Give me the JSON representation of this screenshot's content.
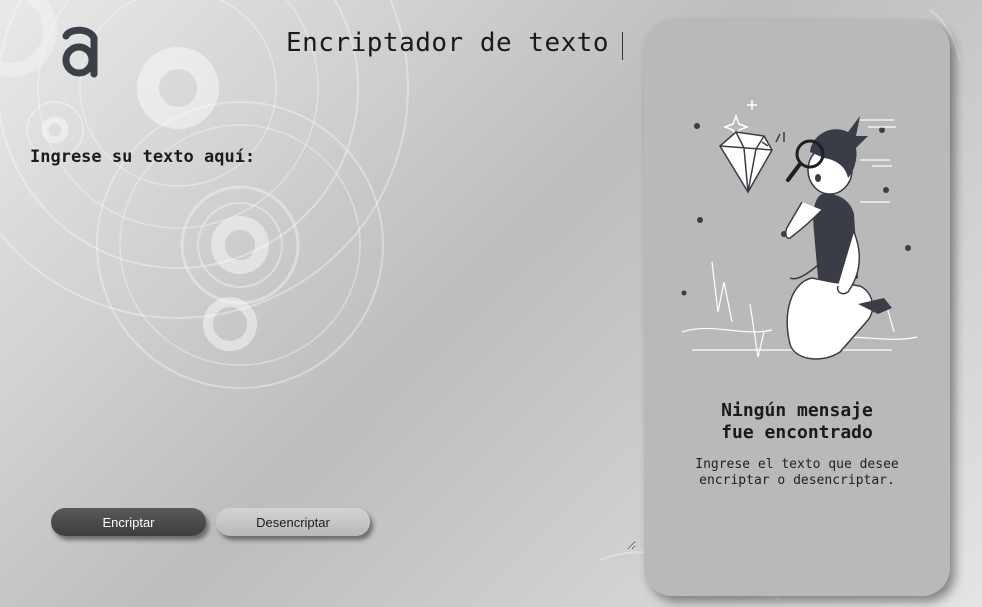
{
  "header": {
    "title": "Encriptador de texto",
    "logo_icon": "alura-a-logo-icon"
  },
  "input": {
    "label": "Ingrese su texto aquí:",
    "value": "",
    "placeholder": ""
  },
  "buttons": {
    "encrypt_label": "Encriptar",
    "decrypt_label": "Desencriptar"
  },
  "output_panel": {
    "illustration_icon": "person-with-magnifying-glass-illustration",
    "heading_line1": "Ningún mensaje",
    "heading_line2": "fue encontrado",
    "message_line1": "Ingrese el texto que desee",
    "message_line2": "encriptar o desencriptar."
  },
  "colors": {
    "primary_button": "#4a4a4a",
    "secondary_button": "#c6c6c6",
    "panel_background": "#b9b9b9",
    "text": "#1a1a1a"
  }
}
